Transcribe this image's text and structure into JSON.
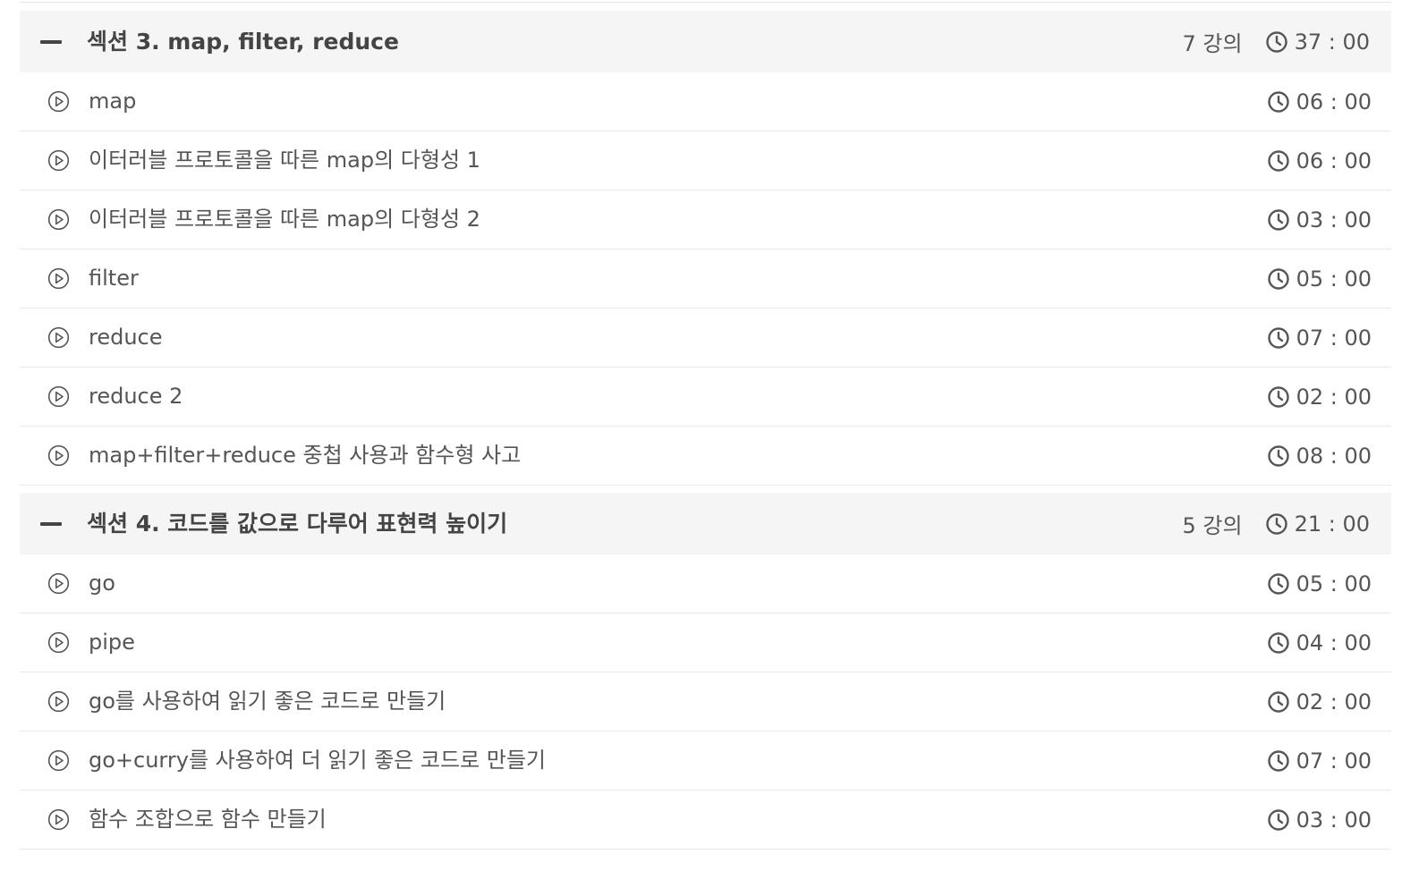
{
  "curriculum": {
    "sections": [
      {
        "title": "섹션 3. map, filter, reduce",
        "lecture_count": "7 강의",
        "duration": "37 : 00",
        "lessons": [
          {
            "title": "map",
            "duration": "06 : 00"
          },
          {
            "title": "이터러블 프로토콜을 따른 map의 다형성 1",
            "duration": "06 : 00"
          },
          {
            "title": "이터러블 프로토콜을 따른 map의 다형성 2",
            "duration": "03 : 00"
          },
          {
            "title": "filter",
            "duration": "05 : 00"
          },
          {
            "title": "reduce",
            "duration": "07 : 00"
          },
          {
            "title": "reduce 2",
            "duration": "02 : 00"
          },
          {
            "title": "map+filter+reduce 중첩 사용과 함수형 사고",
            "duration": "08 : 00"
          }
        ]
      },
      {
        "title": "섹션 4. 코드를 값으로 다루어 표현력 높이기",
        "lecture_count": "5 강의",
        "duration": "21 : 00",
        "lessons": [
          {
            "title": "go",
            "duration": "05 : 00"
          },
          {
            "title": "pipe",
            "duration": "04 : 00"
          },
          {
            "title": "go를 사용하여 읽기 좋은 코드로 만들기",
            "duration": "02 : 00"
          },
          {
            "title": "go+curry를 사용하여 더 읽기 좋은 코드로 만들기",
            "duration": "07 : 00"
          },
          {
            "title": "함수 조합으로 함수 만들기",
            "duration": "03 : 00"
          }
        ]
      }
    ]
  },
  "icons": {
    "collapse": "minus-icon",
    "lesson": "play-circle-icon",
    "duration": "clock-icon"
  },
  "colors": {
    "section_bg": "#f5f5f5",
    "text": "#555555",
    "divider": "#e9e9e9"
  }
}
